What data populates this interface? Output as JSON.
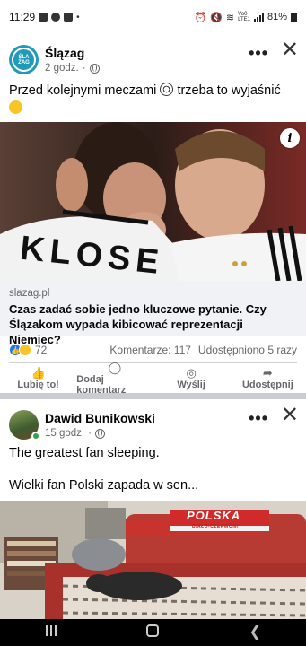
{
  "status_bar": {
    "time": "11:29",
    "net_label_top": "Vo0",
    "net_label_bottom": "LTE1",
    "battery": "81%"
  },
  "post1": {
    "avatar_text_top": "ŚLA",
    "avatar_text_bottom": "ŻAG",
    "author": "Ślązag",
    "time": "2 godz.",
    "separator": "·",
    "more": "•••",
    "close": "✕",
    "text": "Przed kolejnymi meczami",
    "text_after": "trzeba to wyjaśnić",
    "image_jersey_text": "KLOSE",
    "info": "i",
    "link_domain": "slazag.pl",
    "link_title": "Czas zadać sobie jedno kluczowe pytanie. Czy Ślązakom wypada kibicować reprezentacji Niemiec?",
    "reaction_count": "72",
    "comments": "Komentarze: 117",
    "shares": "Udostępniono 5 razy",
    "actions": {
      "like": "Lubię to!",
      "comment": "Dodaj komentarz",
      "send": "Wyślij",
      "share": "Udostępnij"
    }
  },
  "post2": {
    "author": "Dawid Bunikowski",
    "time": "15 godz.",
    "separator": "·",
    "more": "•••",
    "close": "✕",
    "text_line1": "The greatest fan sleeping.",
    "text_line2": "Wielki fan Polski zapada w sen...",
    "image_banner_text": "POLSKA",
    "image_banner_subtext": "BIAŁO-CZERWONI"
  },
  "colors": {
    "facebook_blue": "#1877f2",
    "secondary_text": "#65676b",
    "slazag_brand": "#1f9ab8",
    "online_green": "#31a24c"
  }
}
